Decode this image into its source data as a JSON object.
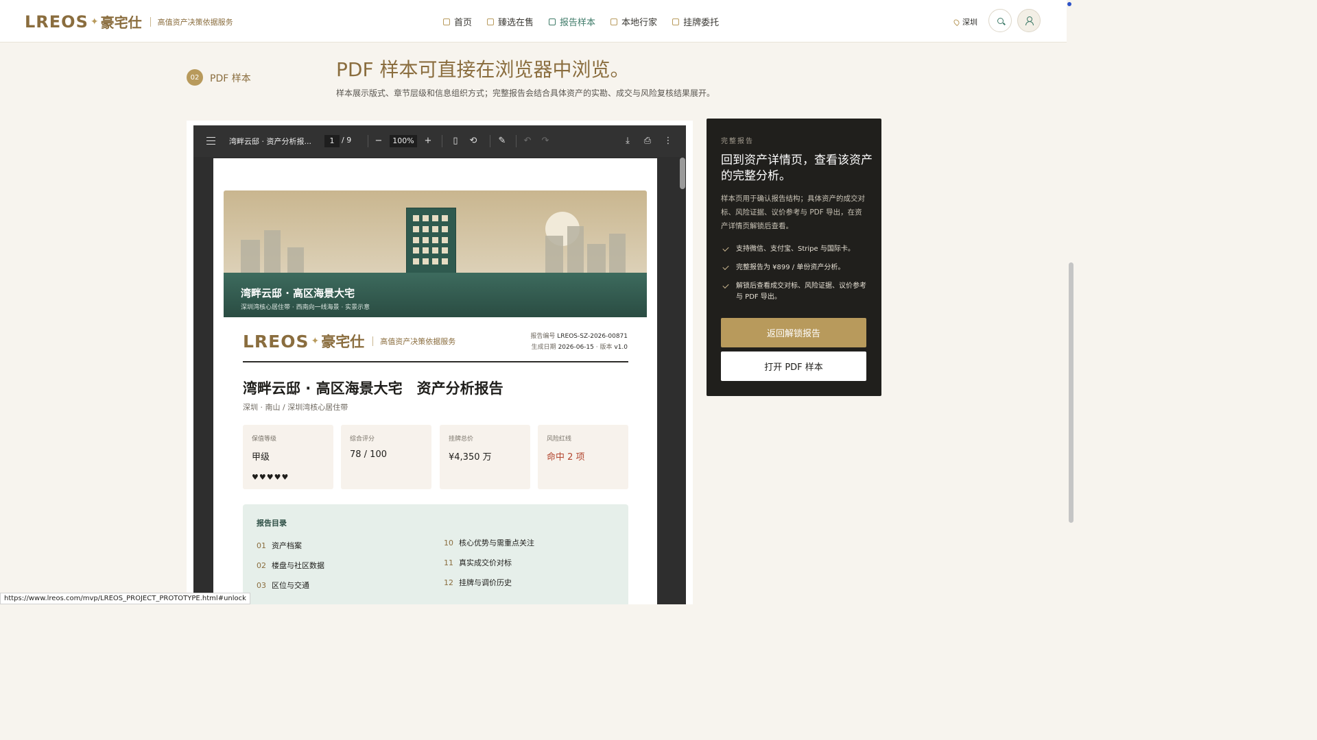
{
  "header": {
    "logo_latin": "LREOS",
    "logo_cn": "豪宅仕",
    "tagline": "高值资产决策依据服务",
    "nav": [
      "首页",
      "臻选在售",
      "报告样本",
      "本地行家",
      "挂牌委托"
    ],
    "active_nav": "报告样本",
    "city": "深圳"
  },
  "section": {
    "badge": "02",
    "label": "PDF 样本",
    "title": "PDF 样本可直接在浏览器中浏览。",
    "desc": "样本展示版式、章节层级和信息组织方式；完整报告会结合具体资产的实勘、成交与风险复核结果展开。"
  },
  "viewer": {
    "doc_title": "湾畔云邸 · 资产分析报...",
    "page": "1",
    "page_total": "/  9",
    "zoom": "100%"
  },
  "pdf": {
    "banner_title": "湾畔云邸 · 高区海景大宅",
    "banner_sub": "深圳湾核心居住带 · 西南向一线海景 · 实景示意",
    "logo_latin": "LREOS",
    "logo_cn": "豪宅仕",
    "tagline": "高值资产决策依据服务",
    "report_no_label": "报告编号",
    "report_no": "LREOS-SZ-2026-00871",
    "gen_label": "生成日期",
    "gen_date": "2026-06-15",
    "version_label": "· 版本",
    "version": "v1.0",
    "title": "湾畔云邸 · 高区海景大宅　资产分析报告",
    "subtitle": "深圳 · 南山 / 深圳湾核心居住带",
    "metrics": [
      {
        "label": "保值等级",
        "value": "甲级",
        "stars": "♥♥♥♥♥"
      },
      {
        "label": "综合评分",
        "value": "78 / 100"
      },
      {
        "label": "挂牌总价",
        "value": "¥4,350 万"
      },
      {
        "label": "风险红线",
        "value": "命中 2 项"
      }
    ],
    "toc_title": "报告目录",
    "toc": [
      {
        "num": "01",
        "text": "资产档案"
      },
      {
        "num": "02",
        "text": "楼盘与社区数据"
      },
      {
        "num": "03",
        "text": "区位与交通"
      },
      {
        "num": "10",
        "text": "核心优势与需重点关注"
      },
      {
        "num": "11",
        "text": "真实成交价对标"
      },
      {
        "num": "12",
        "text": "挂牌与调价历史"
      }
    ]
  },
  "card": {
    "eyebrow": "完整报告",
    "title": "回到资产详情页，查看该资产的完整分析。",
    "desc": "样本页用于确认报告结构；具体资产的成交对标、风险证据、议价参考与 PDF 导出，在资产详情页解锁后查看。",
    "items": [
      "支持微信、支付宝、Stripe 与国际卡。",
      "完整报告为 ¥899 / 单份资产分析。",
      "解锁后查看成交对标、风险证据、议价参考与 PDF 导出。"
    ],
    "primary_btn": "返回解锁报告",
    "secondary_btn": "打开 PDF 样本"
  },
  "status_url": "https://www.lreos.com/mvp/LREOS_PROJECT_PROTOTYPE.html#unlock",
  "colors": {
    "gold": "#b89a5c",
    "green": "#3e7a68",
    "dark": "#201f1c",
    "red": "#b2452e"
  }
}
